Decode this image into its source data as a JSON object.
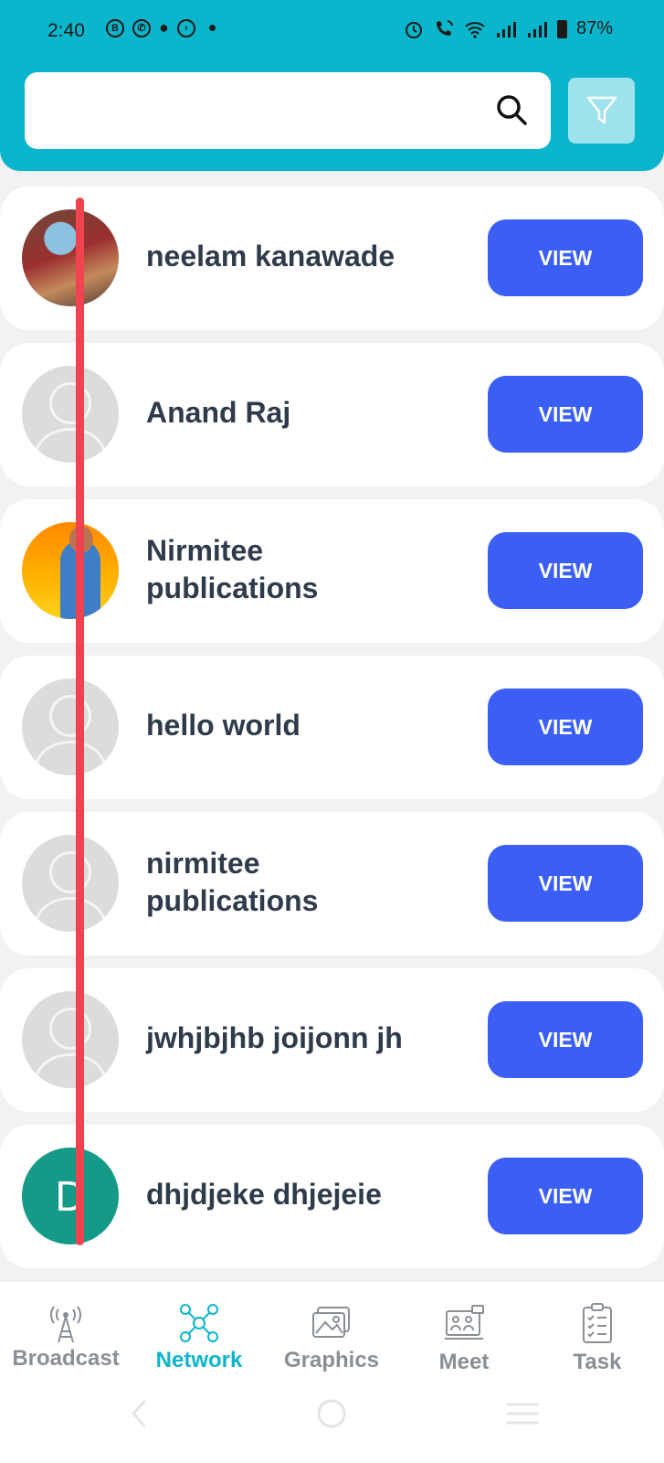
{
  "status_bar": {
    "time": "2:40",
    "battery": "87%",
    "left_icons": [
      "b-icon",
      "whatsapp-icon",
      "chat-icon",
      "messenger-icon",
      "dot-icon"
    ],
    "right_icons": [
      "alarm-icon",
      "call-wifi-icon",
      "wifi-icon",
      "signal-icon",
      "signal-icon",
      "battery-icon"
    ]
  },
  "search": {
    "placeholder": ""
  },
  "contacts": [
    {
      "name": "neelam kanawade",
      "button": "VIEW",
      "avatar": "photo"
    },
    {
      "name": "Anand Raj",
      "button": "VIEW",
      "avatar": "placeholder"
    },
    {
      "name": "Nirmitee publications",
      "button": "VIEW",
      "avatar": "photo"
    },
    {
      "name": "hello world",
      "button": "VIEW",
      "avatar": "placeholder"
    },
    {
      "name": "nirmitee publications",
      "button": "VIEW",
      "avatar": "placeholder"
    },
    {
      "name": "jwhjbjhb joijonn jh",
      "button": "VIEW",
      "avatar": "placeholder"
    },
    {
      "name": "dhjdjeke dhjejeie",
      "button": "VIEW",
      "avatar": "letter",
      "letter": "D"
    }
  ],
  "nav": [
    {
      "label": "Broadcast",
      "icon": "broadcast-tower-icon",
      "active": false
    },
    {
      "label": "Network",
      "icon": "network-icon",
      "active": true
    },
    {
      "label": "Graphics",
      "icon": "image-gallery-icon",
      "active": false
    },
    {
      "label": "Meet",
      "icon": "video-meet-icon",
      "active": false
    },
    {
      "label": "Task",
      "icon": "task-clipboard-icon",
      "active": false
    }
  ],
  "colors": {
    "header": "#0bb5cc",
    "button": "#3b5ff5",
    "active_nav": "#0bb5cc",
    "overlay_line": "#ef4350"
  }
}
